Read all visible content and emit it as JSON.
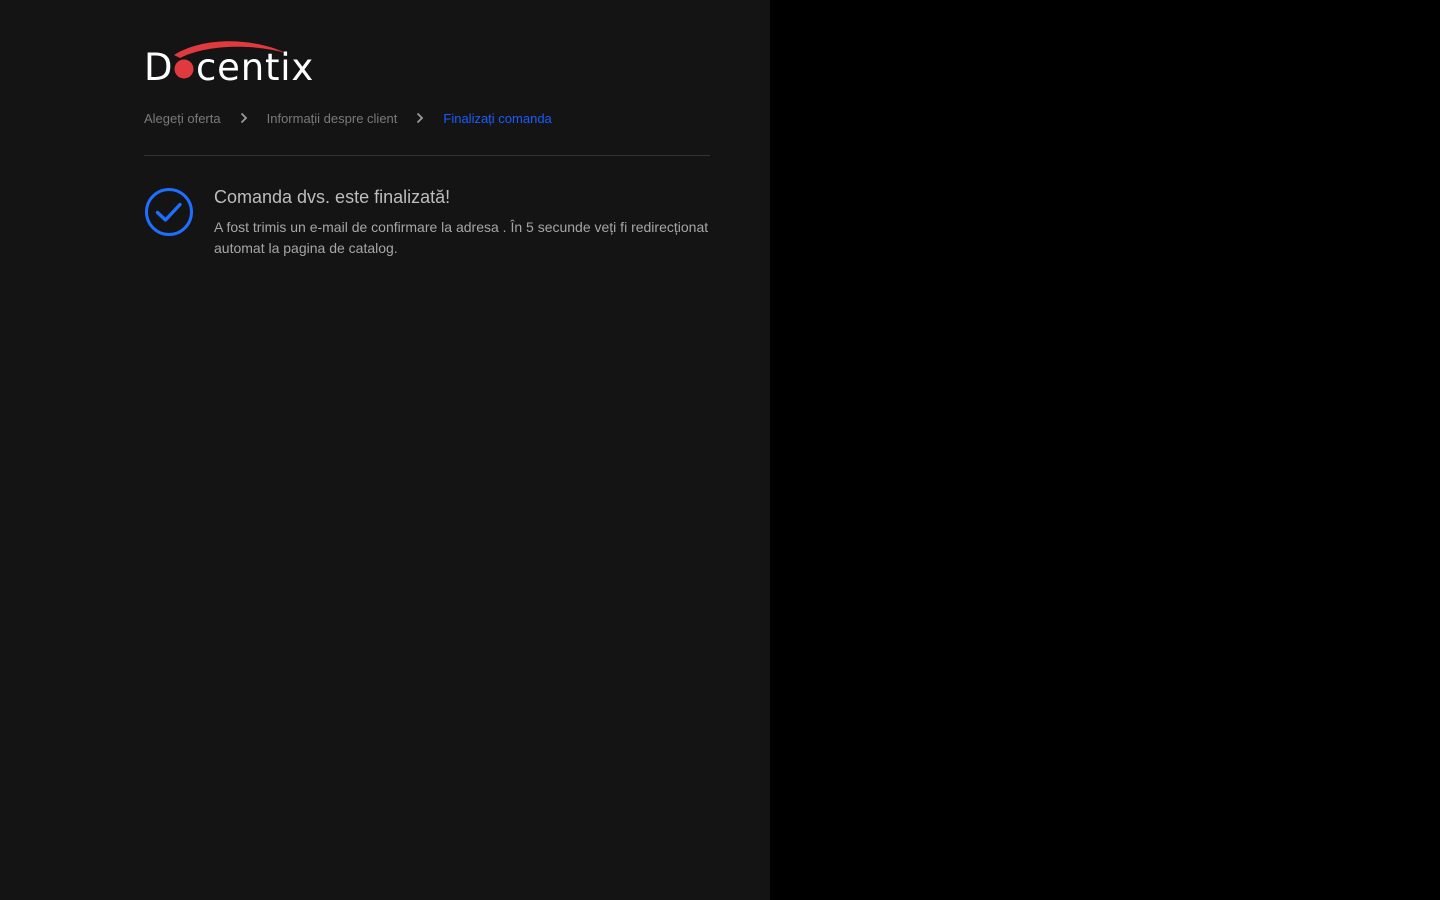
{
  "brand": {
    "logo_text": "Docentix",
    "accent_color": "#e03a3e"
  },
  "breadcrumb": {
    "steps": [
      {
        "label": "Alegeți oferta",
        "state": "done"
      },
      {
        "label": "Informații despre client",
        "state": "done"
      },
      {
        "label": "Finalizați comanda",
        "state": "current"
      }
    ],
    "separator_icon": "chevron-right-icon",
    "active_color": "#1a5cff"
  },
  "confirmation": {
    "icon": "check-circle-icon",
    "icon_color": "#1f6fff",
    "title": "Comanda dvs. este finalizată!",
    "message": "A fost trimis un e-mail de confirmare la adresa . În 5 secunde veți fi redirecționat automat la pagina de catalog."
  }
}
